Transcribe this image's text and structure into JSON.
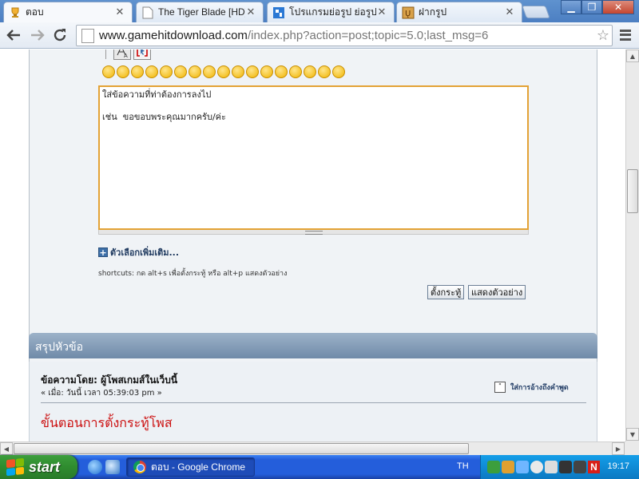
{
  "browser": {
    "tabs": [
      {
        "title": "ตอบ",
        "active": true,
        "favicon": "trophy-icon"
      },
      {
        "title": "The Tiger Blade [HD] เ",
        "active": false,
        "favicon": "page-icon"
      },
      {
        "title": "โปรแกรมย่อรูป ย่อรูปไม่",
        "active": false,
        "favicon": "site-icon"
      },
      {
        "title": "ฝากรูป",
        "active": false,
        "favicon": "image-host-icon"
      }
    ],
    "tab_close_glyph": "✕",
    "url_host": "www.gamehitdownload.com",
    "url_rest": "/index.php?action=post;topic=5.0;last_msg=6"
  },
  "editor": {
    "message_text": "ใส่ข้อความที่ท่าต้องการลงไป\n\nเช่น  ขอขอบพระคุณมากครับ/ค่ะ",
    "smileys": [
      "😊",
      "😉",
      "😀",
      "😄",
      "😠",
      "😐",
      "😕",
      "😎",
      "😲",
      "😇",
      "😛",
      "😢",
      "😮",
      "😳",
      "😨",
      "😶",
      "😒"
    ],
    "more_options_label": "ตัวเลือกเพิ่มเติม...",
    "shortcuts_text": "shortcuts: กด alt+s เพื่อตั้งกระทู้ หรือ alt+p แสดงตัวอย่าง",
    "post_button": "ตั้งกระทู้",
    "preview_button": "แสดงตัวอย่าง"
  },
  "summary": {
    "header": "สรุปหัวข้อ",
    "author_line": "ข้อความโดย: ผู้โพสเกมส์ในเว็บนี้",
    "date_line": "« เมื่อ: วันนี้ เวลา 05:39:03 pm »",
    "quote_label": "ใส่การอ้างถึงคำพูด",
    "post_heading": "ขั้นตอนการตั้งกระทู้โพส"
  },
  "taskbar": {
    "start_label": "start",
    "task_label": "ตอบ - Google Chrome",
    "language": "TH",
    "clock": "19:17",
    "tray_n_label": "N"
  },
  "colors": {
    "textarea_border": "#e3a235",
    "summary_header": "#7f98b5",
    "post_heading": "#cc1111",
    "taskbar_blue": "#245edb",
    "start_green": "#2f8c2f"
  }
}
